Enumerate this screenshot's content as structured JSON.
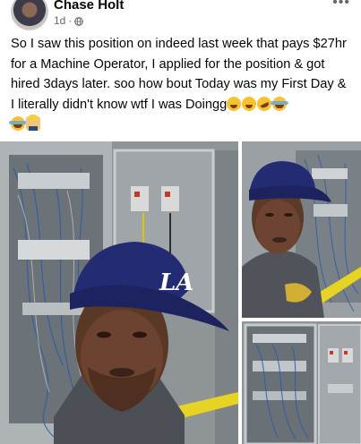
{
  "post": {
    "author": "Chase Holt",
    "time": "1d",
    "separator": "·",
    "text": "So I saw this position on indeed last week that pays $27hr for a Machine Operator, I applied for the position & got hired 3days later. soo how bout Today was my First Day & I literally didn't know wtf I was Doingg",
    "emojis_line1": [
      "weary-face",
      "weary-face",
      "rofl-face",
      "tears-of-joy-face"
    ],
    "emojis_line2": [
      "tears-of-joy-face",
      "construction-worker"
    ]
  },
  "icons": {
    "more": "more-options-icon",
    "privacy": "globe-icon"
  },
  "gallery": {
    "photos": [
      {
        "subject": "selfie-in-front-of-electrical-cabinet",
        "cap_text": "LA"
      },
      {
        "subject": "selfie-with-wiring-panel"
      },
      {
        "subject": "open-control-cabinet-wiring"
      }
    ]
  },
  "colors": {
    "cap": "#232c73",
    "cabinet": "#a7acae",
    "safety_rail": "#e7d324",
    "text_secondary": "#65676b"
  }
}
